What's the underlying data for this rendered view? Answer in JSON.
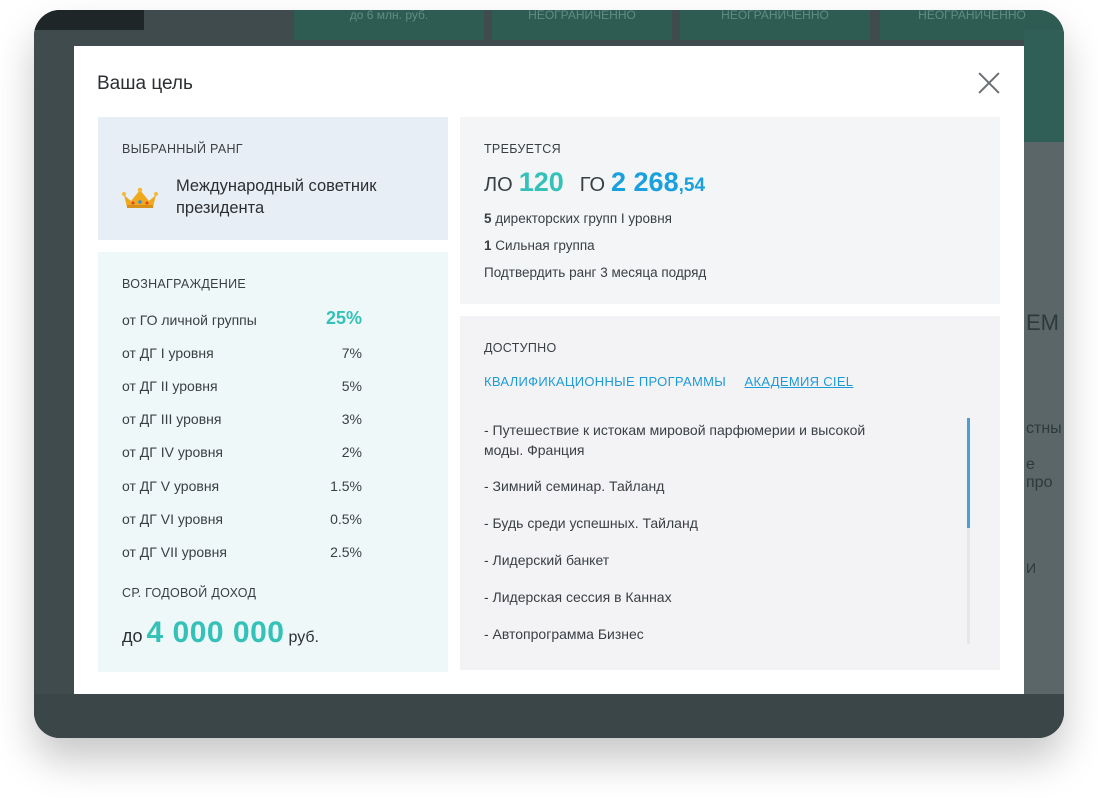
{
  "background": {
    "top_cells": [
      "до 6 млн. руб.",
      "НЕОГРАНИЧЕННО",
      "НЕОГРАНИЧЕННО",
      "НЕОГРАНИЧЕННО"
    ],
    "right_fragments": [
      "ЕМ",
      "стны",
      "е про",
      "И"
    ]
  },
  "modal": {
    "title": "Ваша цель",
    "close_icon": "close-icon"
  },
  "rank": {
    "label": "ВЫБРАННЫЙ РАНГ",
    "icon": "crown-icon",
    "name": "Международный советник президента"
  },
  "reward": {
    "label": "ВОЗНАГРАЖДЕНИЕ",
    "rows": [
      {
        "label": "от ГО личной группы",
        "value": "25%"
      },
      {
        "label": "от ДГ I уровня",
        "value": "7%"
      },
      {
        "label": "от ДГ II уровня",
        "value": "5%"
      },
      {
        "label": "от ДГ III уровня",
        "value": "3%"
      },
      {
        "label": "от ДГ IV уровня",
        "value": "2%"
      },
      {
        "label": "от ДГ V уровня",
        "value": "1.5%"
      },
      {
        "label": "от ДГ VI уровня",
        "value": "0.5%"
      },
      {
        "label": "от ДГ VII уровня",
        "value": "2.5%"
      }
    ],
    "income_label": "СР. ГОДОВОЙ ДОХОД",
    "income_prefix": "до",
    "income_value": "4 000 000",
    "income_unit": "руб."
  },
  "requirements": {
    "label": "ТРЕБУЕТСЯ",
    "lo_prefix": "ЛО",
    "lo_value": "120",
    "go_prefix": "ГО",
    "go_value": "2 268",
    "go_decimal": ",54",
    "lines": [
      {
        "num": "5",
        "text": " директорских групп I уровня"
      },
      {
        "num": "1",
        "text": " Сильная группа"
      },
      {
        "num": "",
        "text": "Подтвердить ранг 3 месяца подряд"
      }
    ]
  },
  "available": {
    "label": "ДОСТУПНО",
    "tabs": [
      {
        "label": "КВАЛИФИКАЦИОННЫЕ ПРОГРАММЫ"
      },
      {
        "label": "АКАДЕМИЯ CIEL"
      }
    ],
    "programs": [
      "- Путешествие к истокам мировой парфюмерии и высокой моды. Франция",
      "- Зимний семинар. Тайланд",
      "- Будь среди успешных. Тайланд",
      "- Лидерский банкет",
      "- Лидерская сессия в Каннах",
      "- Автопрограмма Бизнес"
    ]
  },
  "colors": {
    "accent_teal": "#34c1b8",
    "accent_blue": "#1aa0dc",
    "link_blue": "#1e9bd7"
  }
}
